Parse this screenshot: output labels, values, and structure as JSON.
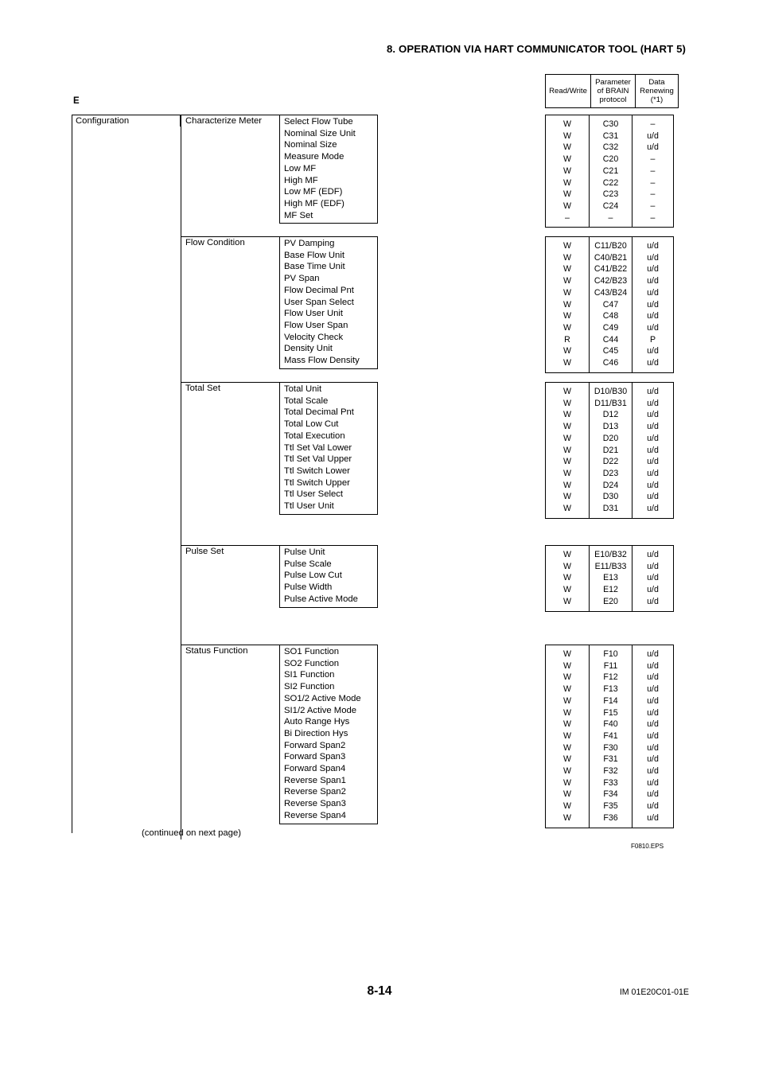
{
  "header": {
    "chapter_title": "8.  OPERATION VIA HART COMMUNICATOR TOOL (HART 5)"
  },
  "key_table": {
    "columns": [
      "Read/Write",
      "Parameter\nof BRAIN\nprotocol",
      "Data\nRenewing\n(*1)"
    ],
    "col1": "Read/Write",
    "col2_line1": "Parameter",
    "col2_line2": "of BRAIN",
    "col2_line3": "protocol",
    "col3_line1": "Data",
    "col3_line2": "Renewing",
    "col3_line3": "(*1)"
  },
  "section_letter": "E",
  "tree": {
    "root": "Configuration",
    "groups": [
      {
        "name": "Characterize Meter",
        "items": [
          "Select Flow Tube",
          "Nominal Size Unit",
          "Nominal Size",
          "Measure Mode",
          "Low MF",
          "High MF",
          "Low MF (EDF)",
          "High MF (EDF)",
          "MF Set"
        ],
        "params": [
          {
            "rw": "W",
            "brain": "C30",
            "renew": "–"
          },
          {
            "rw": "W",
            "brain": "C31",
            "renew": "u/d"
          },
          {
            "rw": "W",
            "brain": "C32",
            "renew": "u/d"
          },
          {
            "rw": "W",
            "brain": "C20",
            "renew": "–"
          },
          {
            "rw": "W",
            "brain": "C21",
            "renew": "–"
          },
          {
            "rw": "W",
            "brain": "C22",
            "renew": "–"
          },
          {
            "rw": "W",
            "brain": "C23",
            "renew": "–"
          },
          {
            "rw": "W",
            "brain": "C24",
            "renew": "–"
          },
          {
            "rw": "–",
            "brain": "–",
            "renew": "–"
          }
        ]
      },
      {
        "name": "Flow Condition",
        "items": [
          "PV Damping",
          "Base Flow Unit",
          "Base Time Unit",
          "PV Span",
          "Flow Decimal Pnt",
          "User Span Select",
          "Flow User Unit",
          "Flow User Span",
          "Velocity Check",
          "Density Unit",
          "Mass Flow Density"
        ],
        "params": [
          {
            "rw": "W",
            "brain": "C11/B20",
            "renew": "u/d"
          },
          {
            "rw": "W",
            "brain": "C40/B21",
            "renew": "u/d"
          },
          {
            "rw": "W",
            "brain": "C41/B22",
            "renew": "u/d"
          },
          {
            "rw": "W",
            "brain": "C42/B23",
            "renew": "u/d"
          },
          {
            "rw": "W",
            "brain": "C43/B24",
            "renew": "u/d"
          },
          {
            "rw": "W",
            "brain": "C47",
            "renew": "u/d"
          },
          {
            "rw": "W",
            "brain": "C48",
            "renew": "u/d"
          },
          {
            "rw": "W",
            "brain": "C49",
            "renew": "u/d"
          },
          {
            "rw": "R",
            "brain": "C44",
            "renew": "P"
          },
          {
            "rw": "W",
            "brain": "C45",
            "renew": "u/d"
          },
          {
            "rw": "W",
            "brain": "C46",
            "renew": "u/d"
          }
        ]
      },
      {
        "name": "Total Set",
        "items": [
          "Total Unit",
          "Total Scale",
          "Total Decimal Pnt",
          "Total Low Cut",
          "Total Execution",
          "Ttl Set Val Lower",
          "Ttl Set Val Upper",
          "Ttl Switch Lower",
          "Ttl Switch Upper",
          "Ttl User Select",
          "Ttl User Unit"
        ],
        "params": [
          {
            "rw": "W",
            "brain": "D10/B30",
            "renew": "u/d"
          },
          {
            "rw": "W",
            "brain": "D11/B31",
            "renew": "u/d"
          },
          {
            "rw": "W",
            "brain": "D12",
            "renew": "u/d"
          },
          {
            "rw": "W",
            "brain": "D13",
            "renew": "u/d"
          },
          {
            "rw": "W",
            "brain": "D20",
            "renew": "u/d"
          },
          {
            "rw": "W",
            "brain": "D21",
            "renew": "u/d"
          },
          {
            "rw": "W",
            "brain": "D22",
            "renew": "u/d"
          },
          {
            "rw": "W",
            "brain": "D23",
            "renew": "u/d"
          },
          {
            "rw": "W",
            "brain": "D24",
            "renew": "u/d"
          },
          {
            "rw": "W",
            "brain": "D30",
            "renew": "u/d"
          },
          {
            "rw": "W",
            "brain": "D31",
            "renew": "u/d"
          }
        ]
      },
      {
        "name": "Pulse Set",
        "items": [
          "Pulse Unit",
          "Pulse Scale",
          "Pulse Low Cut",
          "Pulse Width",
          "Pulse Active Mode"
        ],
        "params": [
          {
            "rw": "W",
            "brain": "E10/B32",
            "renew": "u/d"
          },
          {
            "rw": "W",
            "brain": "E11/B33",
            "renew": "u/d"
          },
          {
            "rw": "W",
            "brain": "E13",
            "renew": "u/d"
          },
          {
            "rw": "W",
            "brain": "E12",
            "renew": "u/d"
          },
          {
            "rw": "W",
            "brain": "E20",
            "renew": "u/d"
          }
        ]
      },
      {
        "name": "Status Function",
        "items": [
          "SO1 Function",
          "SO2 Function",
          "SI1 Function",
          "SI2 Function",
          "SO1/2 Active Mode",
          "SI1/2 Active Mode",
          "Auto Range Hys",
          "Bi Direction Hys",
          "Forward Span2",
          "Forward Span3",
          "Forward Span4",
          "Reverse Span1",
          "Reverse Span2",
          "Reverse Span3",
          "Reverse Span4"
        ],
        "params": [
          {
            "rw": "W",
            "brain": "F10",
            "renew": "u/d"
          },
          {
            "rw": "W",
            "brain": "F11",
            "renew": "u/d"
          },
          {
            "rw": "W",
            "brain": "F12",
            "renew": "u/d"
          },
          {
            "rw": "W",
            "brain": "F13",
            "renew": "u/d"
          },
          {
            "rw": "W",
            "brain": "F14",
            "renew": "u/d"
          },
          {
            "rw": "W",
            "brain": "F15",
            "renew": "u/d"
          },
          {
            "rw": "W",
            "brain": "F40",
            "renew": "u/d"
          },
          {
            "rw": "W",
            "brain": "F41",
            "renew": "u/d"
          },
          {
            "rw": "W",
            "brain": "F30",
            "renew": "u/d"
          },
          {
            "rw": "W",
            "brain": "F31",
            "renew": "u/d"
          },
          {
            "rw": "W",
            "brain": "F32",
            "renew": "u/d"
          },
          {
            "rw": "W",
            "brain": "F33",
            "renew": "u/d"
          },
          {
            "rw": "W",
            "brain": "F34",
            "renew": "u/d"
          },
          {
            "rw": "W",
            "brain": "F35",
            "renew": "u/d"
          },
          {
            "rw": "W",
            "brain": "F36",
            "renew": "u/d"
          }
        ]
      }
    ]
  },
  "notes": {
    "continued": "(continued on next page)",
    "eps": "F0810.EPS"
  },
  "footer": {
    "page_number": "8-14",
    "doc_code": "IM 01E20C01-01E"
  },
  "layout": {
    "group_tops": [
      0,
      153,
      336,
      541,
      666
    ],
    "group_spine_heights": [
      140,
      170,
      192,
      112,
      230
    ],
    "root_spine_height": 888,
    "param_table_tops": [
      144,
      297,
      480,
      685,
      810
    ]
  }
}
